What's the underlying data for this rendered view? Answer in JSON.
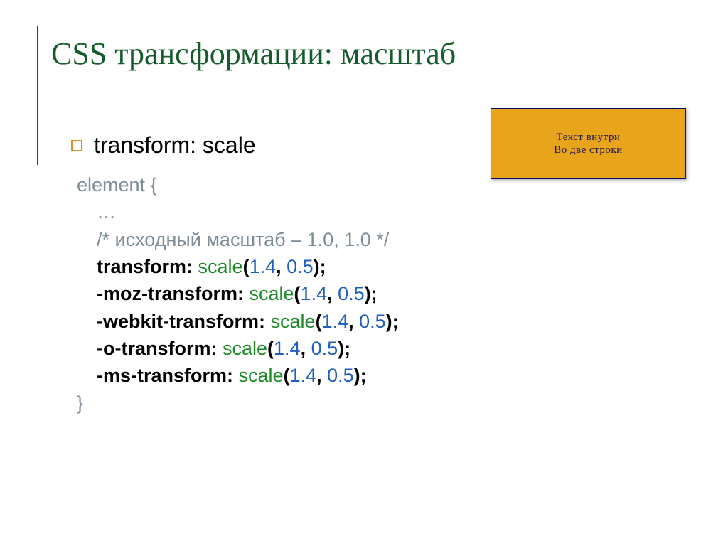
{
  "title": "CSS трансформации: масштаб",
  "bullet_text": "transform: scale",
  "demo": {
    "line1": "Текст внутри",
    "line2": "Во две строки"
  },
  "code": {
    "selector": "element",
    "brace_open": "{",
    "ellipsis": "…",
    "comment": "/* исходный масштаб – 1.0, 1.0 */",
    "lines": [
      {
        "prop": "transform",
        "func": "scale",
        "a": "1.4",
        "b": "0.5"
      },
      {
        "prop": "-moz-transform",
        "func": "scale",
        "a": "1.4",
        "b": "0.5"
      },
      {
        "prop": "-webkit-transform",
        "func": "scale",
        "a": "1.4",
        "b": "0.5"
      },
      {
        "prop": "-o-transform",
        "func": "scale",
        "a": "1.4",
        "b": "0.5"
      },
      {
        "prop": "-ms-transform",
        "func": "scale",
        "a": "1.4",
        "b": "0.5"
      }
    ],
    "brace_close": "}"
  }
}
